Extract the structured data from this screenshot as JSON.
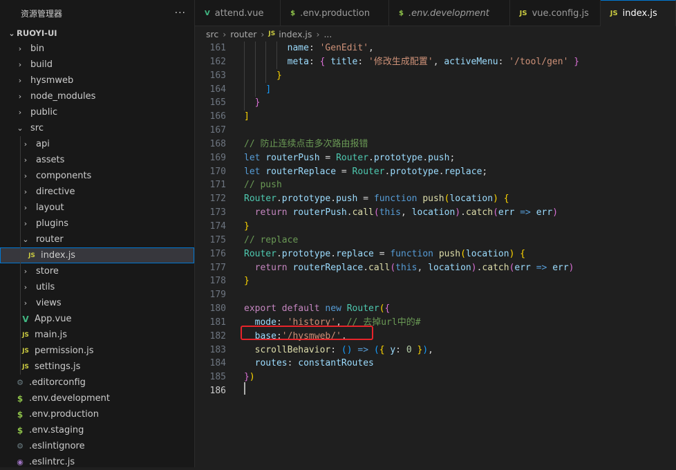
{
  "explorer": {
    "title": "资源管理器",
    "more": "···",
    "project": "RUOYI-UI",
    "items": [
      {
        "label": "bin",
        "type": "folder",
        "depth": 1,
        "open": false
      },
      {
        "label": "build",
        "type": "folder",
        "depth": 1,
        "open": false
      },
      {
        "label": "hysmweb",
        "type": "folder",
        "depth": 1,
        "open": false
      },
      {
        "label": "node_modules",
        "type": "folder",
        "depth": 1,
        "open": false
      },
      {
        "label": "public",
        "type": "folder",
        "depth": 1,
        "open": false
      },
      {
        "label": "src",
        "type": "folder",
        "depth": 1,
        "open": true
      },
      {
        "label": "api",
        "type": "folder",
        "depth": 2,
        "open": false
      },
      {
        "label": "assets",
        "type": "folder",
        "depth": 2,
        "open": false
      },
      {
        "label": "components",
        "type": "folder",
        "depth": 2,
        "open": false
      },
      {
        "label": "directive",
        "type": "folder",
        "depth": 2,
        "open": false
      },
      {
        "label": "layout",
        "type": "folder",
        "depth": 2,
        "open": false
      },
      {
        "label": "plugins",
        "type": "folder",
        "depth": 2,
        "open": false
      },
      {
        "label": "router",
        "type": "folder",
        "depth": 2,
        "open": true
      },
      {
        "label": "index.js",
        "type": "js",
        "depth": 3,
        "selected": true
      },
      {
        "label": "store",
        "type": "folder",
        "depth": 2,
        "open": false
      },
      {
        "label": "utils",
        "type": "folder",
        "depth": 2,
        "open": false
      },
      {
        "label": "views",
        "type": "folder",
        "depth": 2,
        "open": false
      },
      {
        "label": "App.vue",
        "type": "vue",
        "depth": 2
      },
      {
        "label": "main.js",
        "type": "js",
        "depth": 2
      },
      {
        "label": "permission.js",
        "type": "js",
        "depth": 2
      },
      {
        "label": "settings.js",
        "type": "js",
        "depth": 2
      },
      {
        "label": ".editorconfig",
        "type": "gear",
        "depth": 1
      },
      {
        "label": ".env.development",
        "type": "env",
        "depth": 1
      },
      {
        "label": ".env.production",
        "type": "env",
        "depth": 1
      },
      {
        "label": ".env.staging",
        "type": "env",
        "depth": 1
      },
      {
        "label": ".eslintignore",
        "type": "gear",
        "depth": 1
      },
      {
        "label": ".eslintrc.js",
        "type": "esl",
        "depth": 1
      }
    ]
  },
  "tabs": [
    {
      "label": "attend.vue",
      "icon": "vue",
      "active": false,
      "italic": false
    },
    {
      "label": ".env.production",
      "icon": "env",
      "active": false,
      "italic": false
    },
    {
      "label": ".env.development",
      "icon": "env",
      "active": false,
      "italic": true
    },
    {
      "label": "vue.config.js",
      "icon": "js",
      "active": false,
      "italic": false
    },
    {
      "label": "index.js",
      "icon": "js",
      "active": true,
      "italic": false
    }
  ],
  "breadcrumb": {
    "parts": [
      "src",
      "router"
    ],
    "file": "index.js",
    "tail": "..."
  },
  "icons": {
    "vue": "V",
    "env": "$",
    "js": "JS",
    "gear": "⚙",
    "esl": "◉",
    "chev_closed": "›",
    "chev_open": "⌄"
  },
  "editor": {
    "current_line": 186,
    "highlighted_line": 182,
    "lines": [
      {
        "n": 161,
        "indent": 8,
        "t": [
          [
            "prop",
            "name"
          ],
          [
            "p",
            ": "
          ],
          [
            "str",
            "'GenEdit'"
          ],
          [
            "p",
            ","
          ]
        ]
      },
      {
        "n": 162,
        "indent": 8,
        "t": [
          [
            "prop",
            "meta"
          ],
          [
            "p",
            ": "
          ],
          [
            "b2",
            "{"
          ],
          [
            "p",
            " "
          ],
          [
            "prop",
            "title"
          ],
          [
            "p",
            ": "
          ],
          [
            "str",
            "'修改生成配置'"
          ],
          [
            "p",
            ", "
          ],
          [
            "prop",
            "activeMenu"
          ],
          [
            "p",
            ": "
          ],
          [
            "str",
            "'/tool/gen'"
          ],
          [
            "p",
            " "
          ],
          [
            "b2",
            "}"
          ]
        ]
      },
      {
        "n": 163,
        "indent": 6,
        "t": [
          [
            "b1",
            "}"
          ]
        ]
      },
      {
        "n": 164,
        "indent": 4,
        "t": [
          [
            "b3",
            "]"
          ]
        ]
      },
      {
        "n": 165,
        "indent": 2,
        "t": [
          [
            "b2",
            "}"
          ]
        ]
      },
      {
        "n": 166,
        "indent": 0,
        "t": [
          [
            "b1",
            "]"
          ]
        ]
      },
      {
        "n": 167,
        "indent": 0,
        "t": []
      },
      {
        "n": 168,
        "indent": 0,
        "t": [
          [
            "com",
            "// 防止连续点击多次路由报错"
          ]
        ]
      },
      {
        "n": 169,
        "indent": 0,
        "t": [
          [
            "kw",
            "let"
          ],
          [
            "p",
            " "
          ],
          [
            "var",
            "routerPush"
          ],
          [
            "p",
            " = "
          ],
          [
            "cls",
            "Router"
          ],
          [
            "p",
            "."
          ],
          [
            "prop",
            "prototype"
          ],
          [
            "p",
            "."
          ],
          [
            "prop",
            "push"
          ],
          [
            "p",
            ";"
          ]
        ]
      },
      {
        "n": 170,
        "indent": 0,
        "t": [
          [
            "kw",
            "let"
          ],
          [
            "p",
            " "
          ],
          [
            "var",
            "routerReplace"
          ],
          [
            "p",
            " = "
          ],
          [
            "cls",
            "Router"
          ],
          [
            "p",
            "."
          ],
          [
            "prop",
            "prototype"
          ],
          [
            "p",
            "."
          ],
          [
            "prop",
            "replace"
          ],
          [
            "p",
            ";"
          ]
        ]
      },
      {
        "n": 171,
        "indent": 0,
        "t": [
          [
            "com",
            "// push"
          ]
        ]
      },
      {
        "n": 172,
        "indent": 0,
        "t": [
          [
            "cls",
            "Router"
          ],
          [
            "p",
            "."
          ],
          [
            "prop",
            "prototype"
          ],
          [
            "p",
            "."
          ],
          [
            "prop",
            "push"
          ],
          [
            "p",
            " = "
          ],
          [
            "kw",
            "function"
          ],
          [
            "p",
            " "
          ],
          [
            "fn",
            "push"
          ],
          [
            "b1",
            "("
          ],
          [
            "var",
            "location"
          ],
          [
            "b1",
            ")"
          ],
          [
            "p",
            " "
          ],
          [
            "b1",
            "{"
          ]
        ]
      },
      {
        "n": 173,
        "indent": 2,
        "t": [
          [
            "ctrl",
            "return"
          ],
          [
            "p",
            " "
          ],
          [
            "var",
            "routerPush"
          ],
          [
            "p",
            "."
          ],
          [
            "fn",
            "call"
          ],
          [
            "b2",
            "("
          ],
          [
            "kw",
            "this"
          ],
          [
            "p",
            ", "
          ],
          [
            "var",
            "location"
          ],
          [
            "b2",
            ")"
          ],
          [
            "p",
            "."
          ],
          [
            "fn",
            "catch"
          ],
          [
            "b2",
            "("
          ],
          [
            "var",
            "err"
          ],
          [
            "p",
            " "
          ],
          [
            "kw",
            "=>"
          ],
          [
            "p",
            " "
          ],
          [
            "var",
            "err"
          ],
          [
            "b2",
            ")"
          ]
        ]
      },
      {
        "n": 174,
        "indent": 0,
        "t": [
          [
            "b1",
            "}"
          ]
        ]
      },
      {
        "n": 175,
        "indent": 0,
        "t": [
          [
            "com",
            "// replace"
          ]
        ]
      },
      {
        "n": 176,
        "indent": 0,
        "t": [
          [
            "cls",
            "Router"
          ],
          [
            "p",
            "."
          ],
          [
            "prop",
            "prototype"
          ],
          [
            "p",
            "."
          ],
          [
            "prop",
            "replace"
          ],
          [
            "p",
            " = "
          ],
          [
            "kw",
            "function"
          ],
          [
            "p",
            " "
          ],
          [
            "fn",
            "push"
          ],
          [
            "b1",
            "("
          ],
          [
            "var",
            "location"
          ],
          [
            "b1",
            ")"
          ],
          [
            "p",
            " "
          ],
          [
            "b1",
            "{"
          ]
        ]
      },
      {
        "n": 177,
        "indent": 2,
        "t": [
          [
            "ctrl",
            "return"
          ],
          [
            "p",
            " "
          ],
          [
            "var",
            "routerReplace"
          ],
          [
            "p",
            "."
          ],
          [
            "fn",
            "call"
          ],
          [
            "b2",
            "("
          ],
          [
            "kw",
            "this"
          ],
          [
            "p",
            ", "
          ],
          [
            "var",
            "location"
          ],
          [
            "b2",
            ")"
          ],
          [
            "p",
            "."
          ],
          [
            "fn",
            "catch"
          ],
          [
            "b2",
            "("
          ],
          [
            "var",
            "err"
          ],
          [
            "p",
            " "
          ],
          [
            "kw",
            "=>"
          ],
          [
            "p",
            " "
          ],
          [
            "var",
            "err"
          ],
          [
            "b2",
            ")"
          ]
        ]
      },
      {
        "n": 178,
        "indent": 0,
        "t": [
          [
            "b1",
            "}"
          ]
        ]
      },
      {
        "n": 179,
        "indent": 0,
        "t": []
      },
      {
        "n": 180,
        "indent": 0,
        "t": [
          [
            "ctrl",
            "export"
          ],
          [
            "p",
            " "
          ],
          [
            "ctrl",
            "default"
          ],
          [
            "p",
            " "
          ],
          [
            "kw",
            "new"
          ],
          [
            "p",
            " "
          ],
          [
            "cls",
            "Router"
          ],
          [
            "b1",
            "("
          ],
          [
            "b2",
            "{"
          ]
        ]
      },
      {
        "n": 181,
        "indent": 2,
        "t": [
          [
            "prop",
            "mode"
          ],
          [
            "p",
            ": "
          ],
          [
            "str",
            "'history'"
          ],
          [
            "p",
            ", "
          ],
          [
            "com",
            "// 去掉url中的#"
          ]
        ]
      },
      {
        "n": 182,
        "indent": 2,
        "t": [
          [
            "prop",
            "base"
          ],
          [
            "p",
            ":"
          ],
          [
            "str",
            "'/hysmweb/'"
          ],
          [
            "p",
            ","
          ]
        ]
      },
      {
        "n": 183,
        "indent": 2,
        "t": [
          [
            "fn",
            "scrollBehavior"
          ],
          [
            "p",
            ": "
          ],
          [
            "b3",
            "()"
          ],
          [
            "p",
            " "
          ],
          [
            "kw",
            "=>"
          ],
          [
            "p",
            " "
          ],
          [
            "b3",
            "("
          ],
          [
            "b1",
            "{"
          ],
          [
            "p",
            " "
          ],
          [
            "prop",
            "y"
          ],
          [
            "p",
            ": "
          ],
          [
            "num",
            "0"
          ],
          [
            "p",
            " "
          ],
          [
            "b1",
            "}"
          ],
          [
            "b3",
            ")"
          ],
          [
            "p",
            ","
          ]
        ]
      },
      {
        "n": 184,
        "indent": 2,
        "t": [
          [
            "prop",
            "routes"
          ],
          [
            "p",
            ": "
          ],
          [
            "var",
            "constantRoutes"
          ]
        ]
      },
      {
        "n": 185,
        "indent": 0,
        "t": [
          [
            "b2",
            "}"
          ],
          [
            "b1",
            ")"
          ]
        ]
      },
      {
        "n": 186,
        "indent": 0,
        "t": []
      }
    ]
  }
}
